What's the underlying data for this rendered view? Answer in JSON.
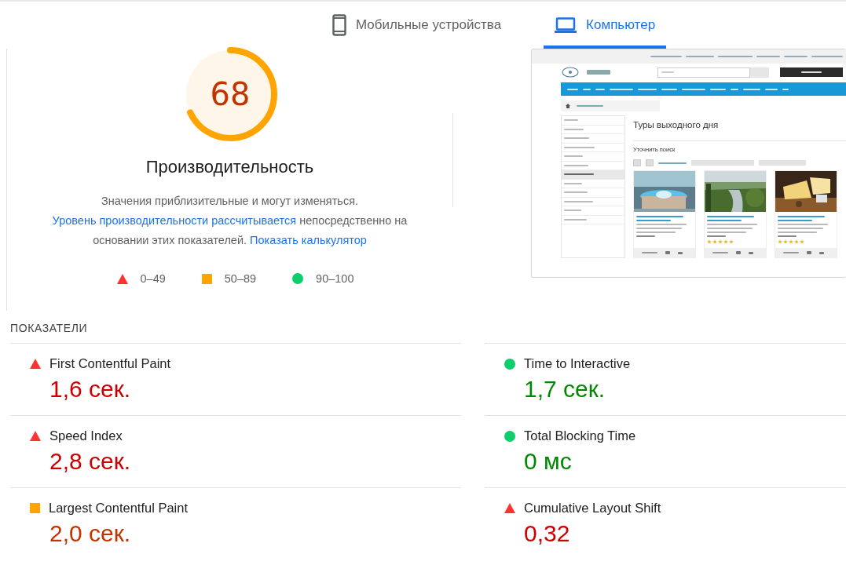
{
  "tabs": [
    {
      "label": "Мобильные устройства",
      "kind": "mobile",
      "selected": false
    },
    {
      "label": "Компьютер",
      "kind": "desktop",
      "selected": true
    }
  ],
  "score": {
    "value": "68",
    "level": 0.68,
    "kind": "square"
  },
  "category_title": "Производительность",
  "description": [
    {
      "kind": "text",
      "text": "Значения приблизительные и могут изменяться. "
    },
    {
      "kind": "link",
      "text": "Уровень производительности рассчитывается"
    },
    {
      "kind": "text",
      "text": " непосредственно на основании этих показателей. "
    },
    {
      "kind": "link",
      "text": "Показать калькулятор"
    }
  ],
  "legend": [
    {
      "kind": "triangle",
      "label": "0–49"
    },
    {
      "kind": "square",
      "label": "50–89"
    },
    {
      "kind": "circle",
      "label": "90–100"
    }
  ],
  "screenshot": {
    "heading": "Туры выходного дня",
    "subheading": "Уточнить поиск",
    "sidebar_items": [
      {
        "selected": false
      },
      {
        "selected": false
      },
      {
        "selected": false
      },
      {
        "selected": false
      },
      {
        "selected": false
      },
      {
        "selected": false
      },
      {
        "selected": true
      },
      {
        "selected": false
      },
      {
        "selected": false
      },
      {
        "selected": false
      },
      {
        "selected": false
      },
      {
        "selected": false
      }
    ],
    "cards": [
      {
        "kind": "picture"
      },
      {
        "kind": "picture",
        "stars": 5
      },
      {
        "kind": "picture",
        "stars": 5
      }
    ]
  },
  "metrics_title": "ПОКАЗАТЕЛИ",
  "metrics": [
    {
      "label": "First Contentful Paint",
      "value": "1,6 сек.",
      "kind": "triangle"
    },
    {
      "label": "Time to Interactive",
      "value": "1,7 сек.",
      "kind": "circle"
    },
    {
      "label": "Speed Index",
      "value": "2,8 сек.",
      "kind": "triangle"
    },
    {
      "label": "Total Blocking Time",
      "value": "0 мс",
      "kind": "circle"
    },
    {
      "label": "Largest Contentful Paint",
      "value": "2,0 сек.",
      "kind": "square"
    },
    {
      "label": "Cumulative Layout Shift",
      "value": "0,32",
      "kind": "triangle"
    }
  ]
}
